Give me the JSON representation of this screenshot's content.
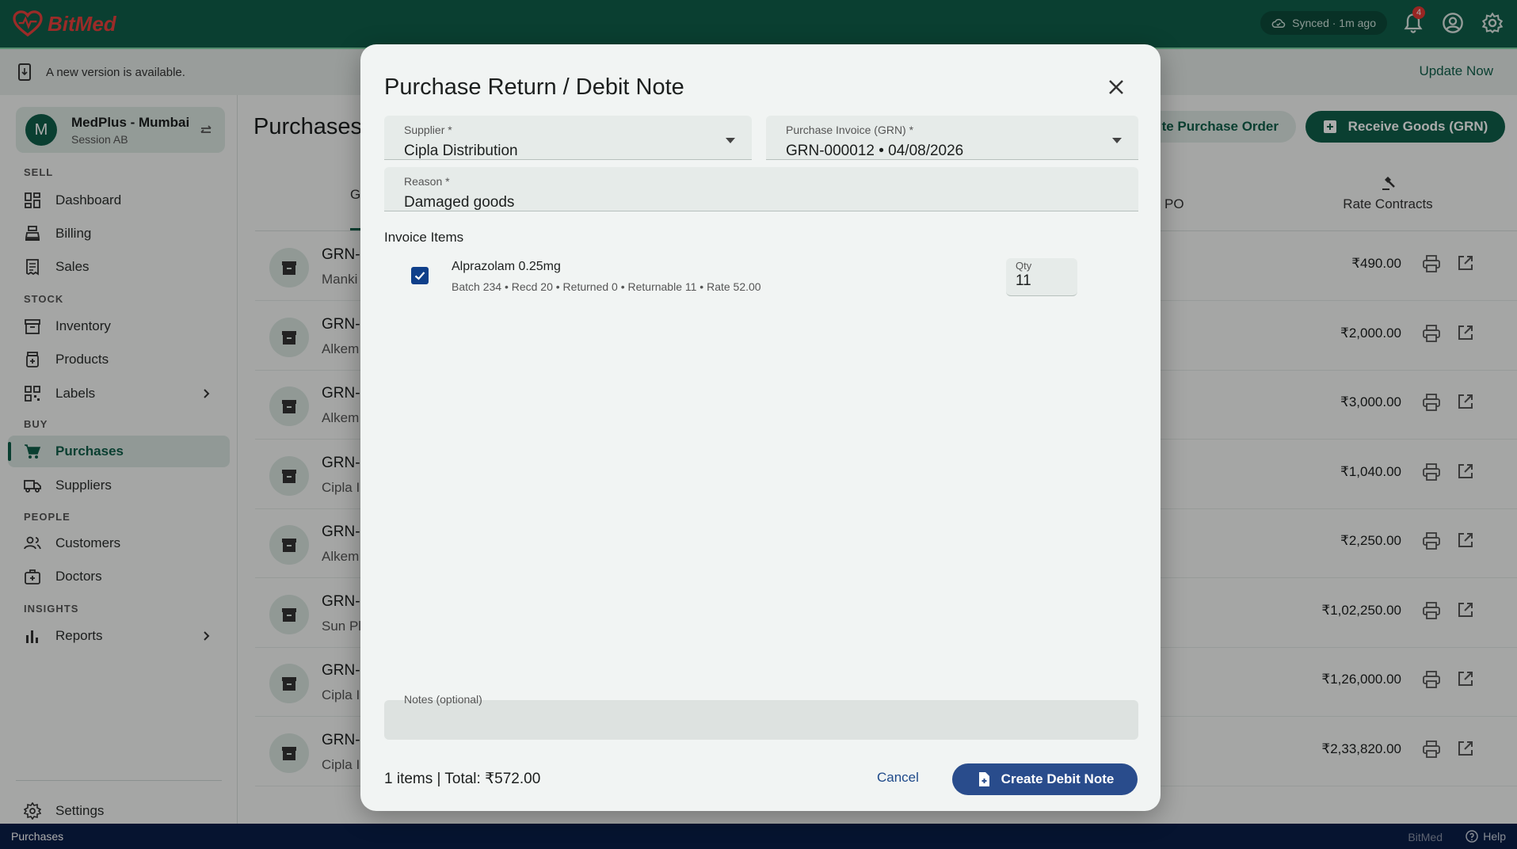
{
  "app": {
    "brand": "BitMed",
    "sync_status": "Synced · 1m ago",
    "notification_count": "4"
  },
  "banner": {
    "message": "A new version is available.",
    "action": "Update Now"
  },
  "store": {
    "initial": "M",
    "name": "MedPlus - Mumbai",
    "session": "Session AB"
  },
  "sidebar": {
    "sections": {
      "sell": "SELL",
      "stock": "STOCK",
      "buy": "BUY",
      "people": "PEOPLE",
      "insights": "INSIGHTS"
    },
    "items": {
      "dashboard": "Dashboard",
      "billing": "Billing",
      "sales": "Sales",
      "inventory": "Inventory",
      "products": "Products",
      "labels": "Labels",
      "purchases": "Purchases",
      "suppliers": "Suppliers",
      "customers": "Customers",
      "doctors": "Doctors",
      "reports": "Reports",
      "settings": "Settings"
    }
  },
  "main": {
    "title": "Purchases",
    "create_po_label": "te Purchase Order",
    "receive_goods_label": "Receive Goods (GRN)",
    "tabs": {
      "first": "G",
      "po": "PO",
      "rate_contracts": "Rate Contracts"
    },
    "rows": [
      {
        "id": "GRN-",
        "sub": "Manki",
        "amount": "₹490.00"
      },
      {
        "id": "GRN-",
        "sub": "Alkem",
        "amount": "₹2,000.00"
      },
      {
        "id": "GRN-",
        "sub": "Alkem",
        "amount": "₹3,000.00"
      },
      {
        "id": "GRN-",
        "sub": "Cipla I",
        "amount": "₹1,040.00"
      },
      {
        "id": "GRN-",
        "sub": "Alkem",
        "amount": "₹2,250.00"
      },
      {
        "id": "GRN-",
        "sub": "Sun Pl",
        "amount": "₹1,02,250.00"
      },
      {
        "id": "GRN-",
        "sub": "Cipla I",
        "amount": "₹1,26,000.00"
      },
      {
        "id": "GRN-",
        "sub": "Cipla I",
        "amount": "₹2,33,820.00"
      }
    ]
  },
  "dialog": {
    "title": "Purchase Return / Debit Note",
    "supplier": {
      "label": "Supplier *",
      "value": "Cipla Distribution"
    },
    "invoice": {
      "label": "Purchase Invoice (GRN) *",
      "value": "GRN-000012 • 04/08/2026"
    },
    "reason": {
      "label": "Reason *",
      "value": "Damaged goods"
    },
    "items_title": "Invoice Items",
    "items": [
      {
        "name": "Alprazolam 0.25mg",
        "meta": "Batch 234 • Recd 20 • Returned 0 • Returnable 11 • Rate 52.00",
        "qty_label": "Qty",
        "qty": "11",
        "checked": true
      }
    ],
    "notes_label": "Notes (optional)",
    "summary": "1 items | Total: ₹572.00",
    "cancel_label": "Cancel",
    "create_label": "Create Debit Note"
  },
  "statusbar": {
    "page": "Purchases",
    "brand": "BitMed",
    "help": "Help"
  }
}
